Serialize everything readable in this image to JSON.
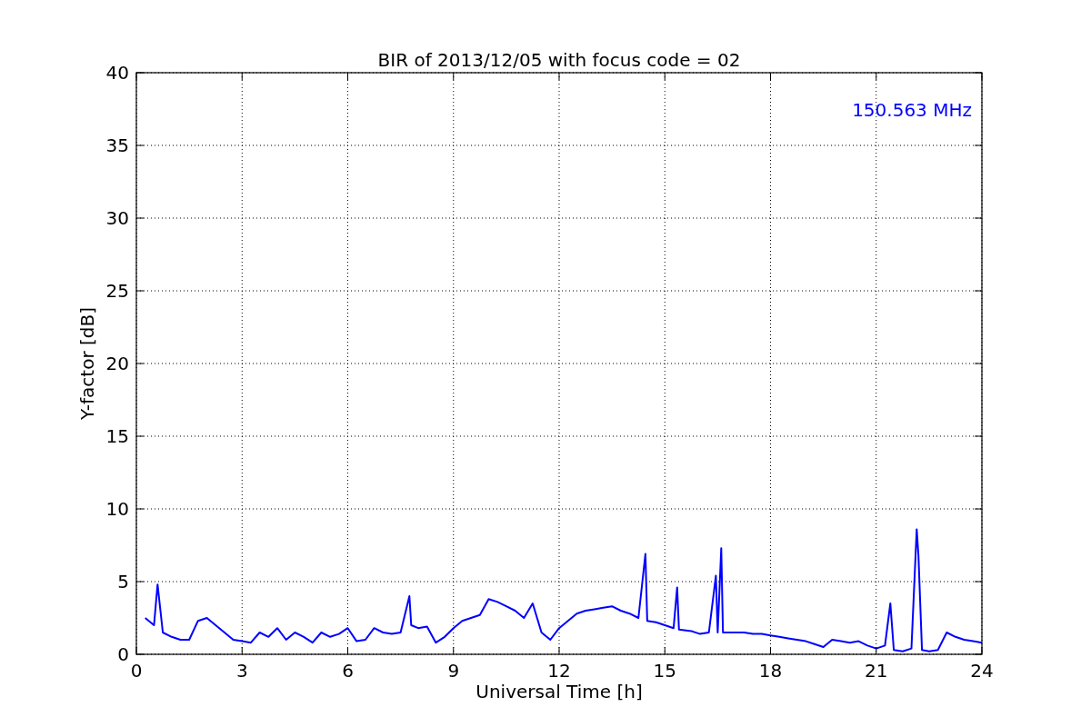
{
  "chart": {
    "chart_data": {
      "type": "line",
      "title": "BIR of 2013/12/05 with focus code = 02",
      "xlabel": "Universal Time [h]",
      "ylabel": "Y-factor [dB]",
      "x": [
        0.25,
        0.5,
        0.6,
        0.75,
        1.0,
        1.25,
        1.5,
        1.75,
        2.0,
        2.25,
        2.5,
        2.75,
        3.0,
        3.25,
        3.5,
        3.75,
        4.0,
        4.25,
        4.5,
        4.75,
        5.0,
        5.25,
        5.5,
        5.75,
        6.0,
        6.25,
        6.5,
        6.75,
        7.0,
        7.25,
        7.5,
        7.75,
        7.8,
        8.0,
        8.25,
        8.5,
        8.75,
        9.0,
        9.25,
        9.5,
        9.75,
        10.0,
        10.25,
        10.5,
        10.75,
        11.0,
        11.25,
        11.5,
        11.75,
        12.0,
        12.25,
        12.5,
        12.75,
        13.0,
        13.25,
        13.5,
        13.75,
        14.0,
        14.25,
        14.45,
        14.5,
        14.75,
        15.0,
        15.25,
        15.35,
        15.4,
        15.75,
        16.0,
        16.25,
        16.45,
        16.5,
        16.6,
        16.65,
        17.0,
        17.25,
        17.5,
        17.75,
        18.0,
        18.25,
        18.5,
        18.75,
        19.0,
        19.25,
        19.5,
        19.75,
        20.0,
        20.25,
        20.5,
        20.75,
        21.0,
        21.25,
        21.4,
        21.5,
        21.75,
        22.0,
        22.15,
        22.2,
        22.3,
        22.5,
        22.75,
        23.0,
        23.25,
        23.5,
        23.75,
        24.0
      ],
      "series": [
        {
          "name": "150.563 MHz",
          "color": "#0000ff",
          "values": [
            2.5,
            2.0,
            4.8,
            1.5,
            1.2,
            1.0,
            1.0,
            2.3,
            2.5,
            2.0,
            1.5,
            1.0,
            0.9,
            0.8,
            1.5,
            1.2,
            1.8,
            1.0,
            1.5,
            1.2,
            0.8,
            1.5,
            1.2,
            1.4,
            1.8,
            0.9,
            1.0,
            1.8,
            1.5,
            1.4,
            1.5,
            4.0,
            2.0,
            1.8,
            1.9,
            0.8,
            1.2,
            1.8,
            2.3,
            2.5,
            2.7,
            3.8,
            3.6,
            3.3,
            3.0,
            2.5,
            3.5,
            1.5,
            1.0,
            1.8,
            2.3,
            2.8,
            3.0,
            3.1,
            3.2,
            3.3,
            3.0,
            2.8,
            2.5,
            6.9,
            2.3,
            2.2,
            2.0,
            1.8,
            4.6,
            1.7,
            1.6,
            1.4,
            1.5,
            5.4,
            1.5,
            7.3,
            1.5,
            1.5,
            1.5,
            1.4,
            1.4,
            1.3,
            1.2,
            1.1,
            1.0,
            0.9,
            0.7,
            0.5,
            1.0,
            0.9,
            0.8,
            0.9,
            0.6,
            0.4,
            0.6,
            3.5,
            0.3,
            0.2,
            0.4,
            8.6,
            6.8,
            0.3,
            0.2,
            0.3,
            1.5,
            1.2,
            1.0,
            0.9,
            0.8
          ]
        }
      ],
      "xlim": [
        0,
        24
      ],
      "ylim": [
        0,
        40
      ],
      "xticks": [
        0,
        3,
        6,
        9,
        12,
        15,
        18,
        21,
        24
      ],
      "yticks": [
        0,
        5,
        10,
        15,
        20,
        25,
        30,
        35,
        40
      ],
      "grid": true
    }
  }
}
